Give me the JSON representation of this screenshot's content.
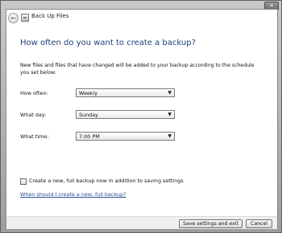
{
  "window": {
    "close_glyph": "×"
  },
  "nav": {
    "back_icon": "back-arrow-icon",
    "app_icon": "backup-icon",
    "title": "Back Up Files"
  },
  "main": {
    "heading": "How often do you want to create a backup?",
    "description": "New files and files that have changed will be added to your backup according to the schedule you set below."
  },
  "schedule": {
    "how_often": {
      "label": "How often:",
      "value": "Weekly"
    },
    "what_day": {
      "label": "What day:",
      "value": "Sunday"
    },
    "what_time": {
      "label": "What time:",
      "value": "7:00 PM"
    }
  },
  "options": {
    "full_backup_checked": false,
    "full_backup_label": "Create a new, full backup now in addition to saving settings",
    "help_link": "When should I create a new, full backup?"
  },
  "footer": {
    "save_label": "Save settings and exit",
    "cancel_label": "Cancel"
  }
}
